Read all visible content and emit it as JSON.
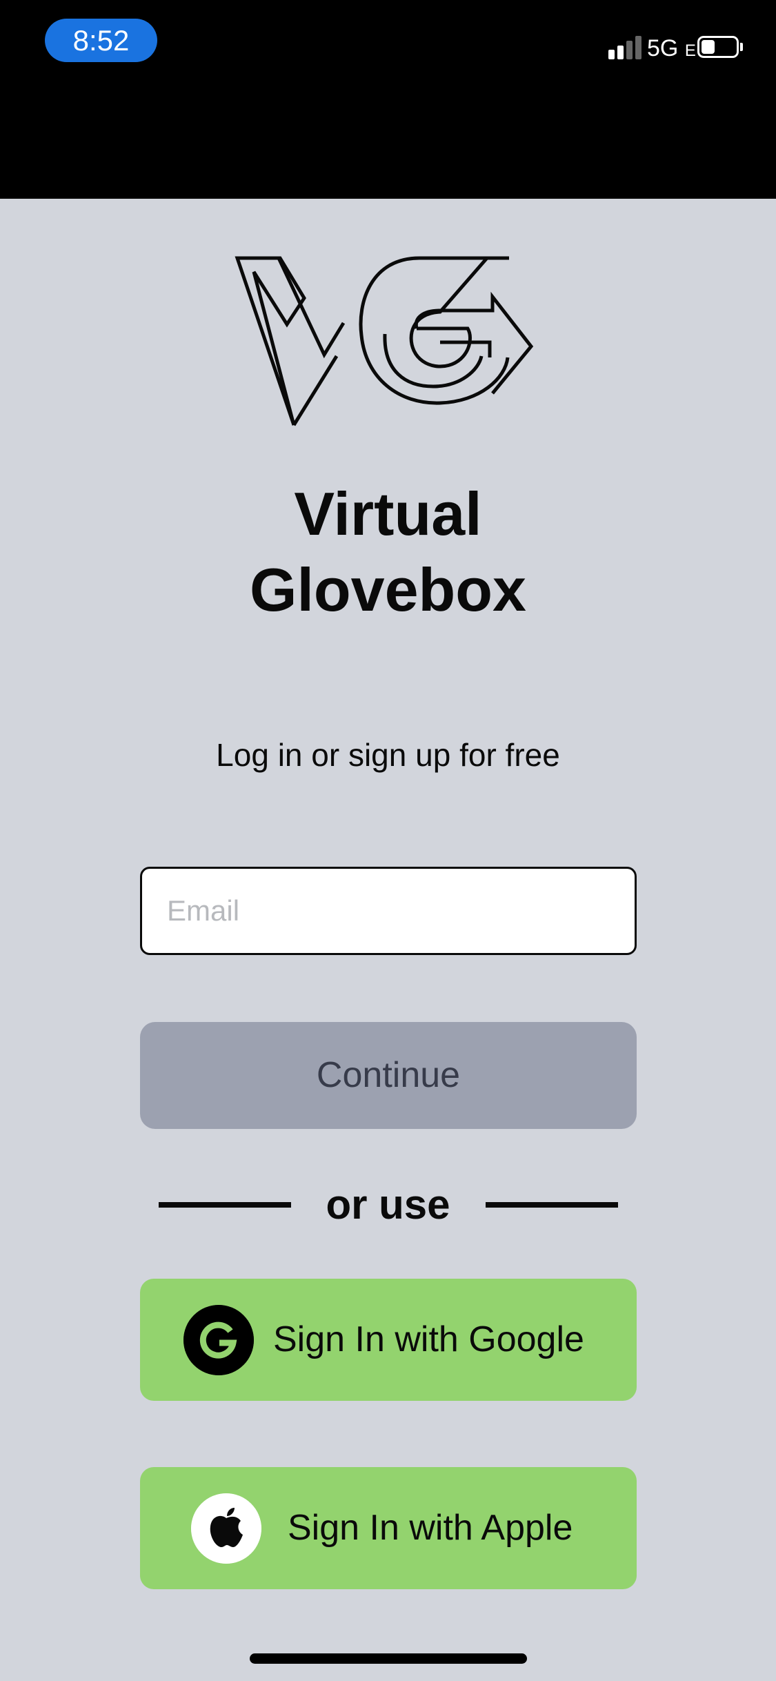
{
  "status_bar": {
    "time": "8:52",
    "network": "5G",
    "network_suffix": "E",
    "battery_level": 0.4,
    "signal_bars_active": 2,
    "signal_bars_total": 4,
    "colors": {
      "time_pill": "#1a73e0"
    }
  },
  "brand": {
    "logo_icon": "vg-arrow-logo-icon",
    "title_line1": "Virtual",
    "title_line2": "Glovebox"
  },
  "auth": {
    "subtitle": "Log in or sign up for free",
    "email_placeholder": "Email",
    "email_value": "",
    "continue_label": "Continue",
    "continue_enabled": false,
    "divider_label": "or use",
    "google_label": "Sign In with Google",
    "google_icon": "google-g-icon",
    "apple_label": "Sign In with Apple",
    "apple_icon": "apple-icon"
  },
  "colors": {
    "background": "#d2d5dc",
    "social_button": "#93d36e",
    "continue_disabled": "#9ca1b0"
  }
}
